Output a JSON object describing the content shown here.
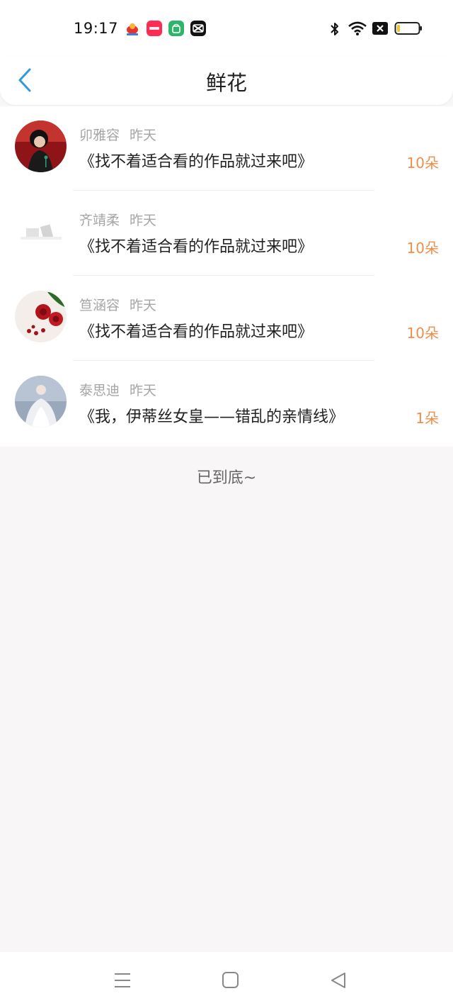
{
  "status_bar": {
    "time": "19:17",
    "app_icons": [
      {
        "name": "weibo-app-icon",
        "color": "#e8332d"
      },
      {
        "name": "xiaohongshu-app-icon",
        "color": "#fe2c55"
      },
      {
        "name": "shopping-bag-app-icon",
        "color": "#2fb56b"
      },
      {
        "name": "capcut-app-icon",
        "color": "#111111"
      }
    ],
    "system_icons": [
      "bluetooth-icon",
      "wifi-icon",
      "no-sim-icon",
      "battery-icon"
    ]
  },
  "header": {
    "title": "鲜花",
    "back_icon": "chevron-left-icon",
    "accent_color": "#2f9ae0"
  },
  "list": {
    "items": [
      {
        "user": "卯雅容",
        "date": "昨天",
        "work": "《找不着适合看的作品就过来吧》",
        "count": "10朵"
      },
      {
        "user": "齐靖柔",
        "date": "昨天",
        "work": "《找不着适合看的作品就过来吧》",
        "count": "10朵"
      },
      {
        "user": "笪涵容",
        "date": "昨天",
        "work": "《找不着适合看的作品就过来吧》",
        "count": "10朵"
      },
      {
        "user": "泰思迪",
        "date": "昨天",
        "work": "《我，伊蒂丝女皇——错乱的亲情线》",
        "count": "1朵"
      }
    ]
  },
  "footer_note": "已到底~",
  "colors": {
    "count": "#ee8e4a",
    "meta": "#a5a5a5",
    "background": "#f8f6f7"
  },
  "nav_bar": {
    "icons": [
      "menu-icon",
      "home-square-icon",
      "back-triangle-icon"
    ]
  }
}
